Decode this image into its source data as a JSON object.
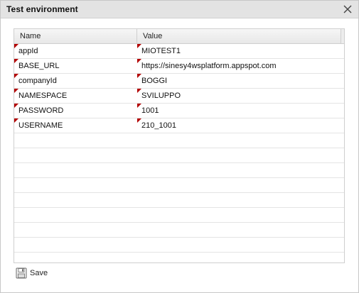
{
  "dialog": {
    "title": "Test environment",
    "close_icon": "close-icon"
  },
  "grid": {
    "columns": [
      "Name",
      "Value"
    ],
    "rows": [
      {
        "name": "appId",
        "value": "MIOTEST1",
        "dirty": true
      },
      {
        "name": "BASE_URL",
        "value": "https://sinesy4wsplatform.appspot.com",
        "dirty": true
      },
      {
        "name": "companyId",
        "value": "BOGGI",
        "dirty": true
      },
      {
        "name": "NAMESPACE",
        "value": "SVILUPPO",
        "dirty": true
      },
      {
        "name": "PASSWORD",
        "value": "1001",
        "dirty": true
      },
      {
        "name": "USERNAME",
        "value": "210_1001",
        "dirty": true
      }
    ],
    "empty_rows": 8
  },
  "toolbar": {
    "save_label": "Save",
    "save_icon": "floppy-disk-icon"
  },
  "colors": {
    "dirty_marker": "#b30000",
    "titlebar": "#e3e3e3"
  }
}
